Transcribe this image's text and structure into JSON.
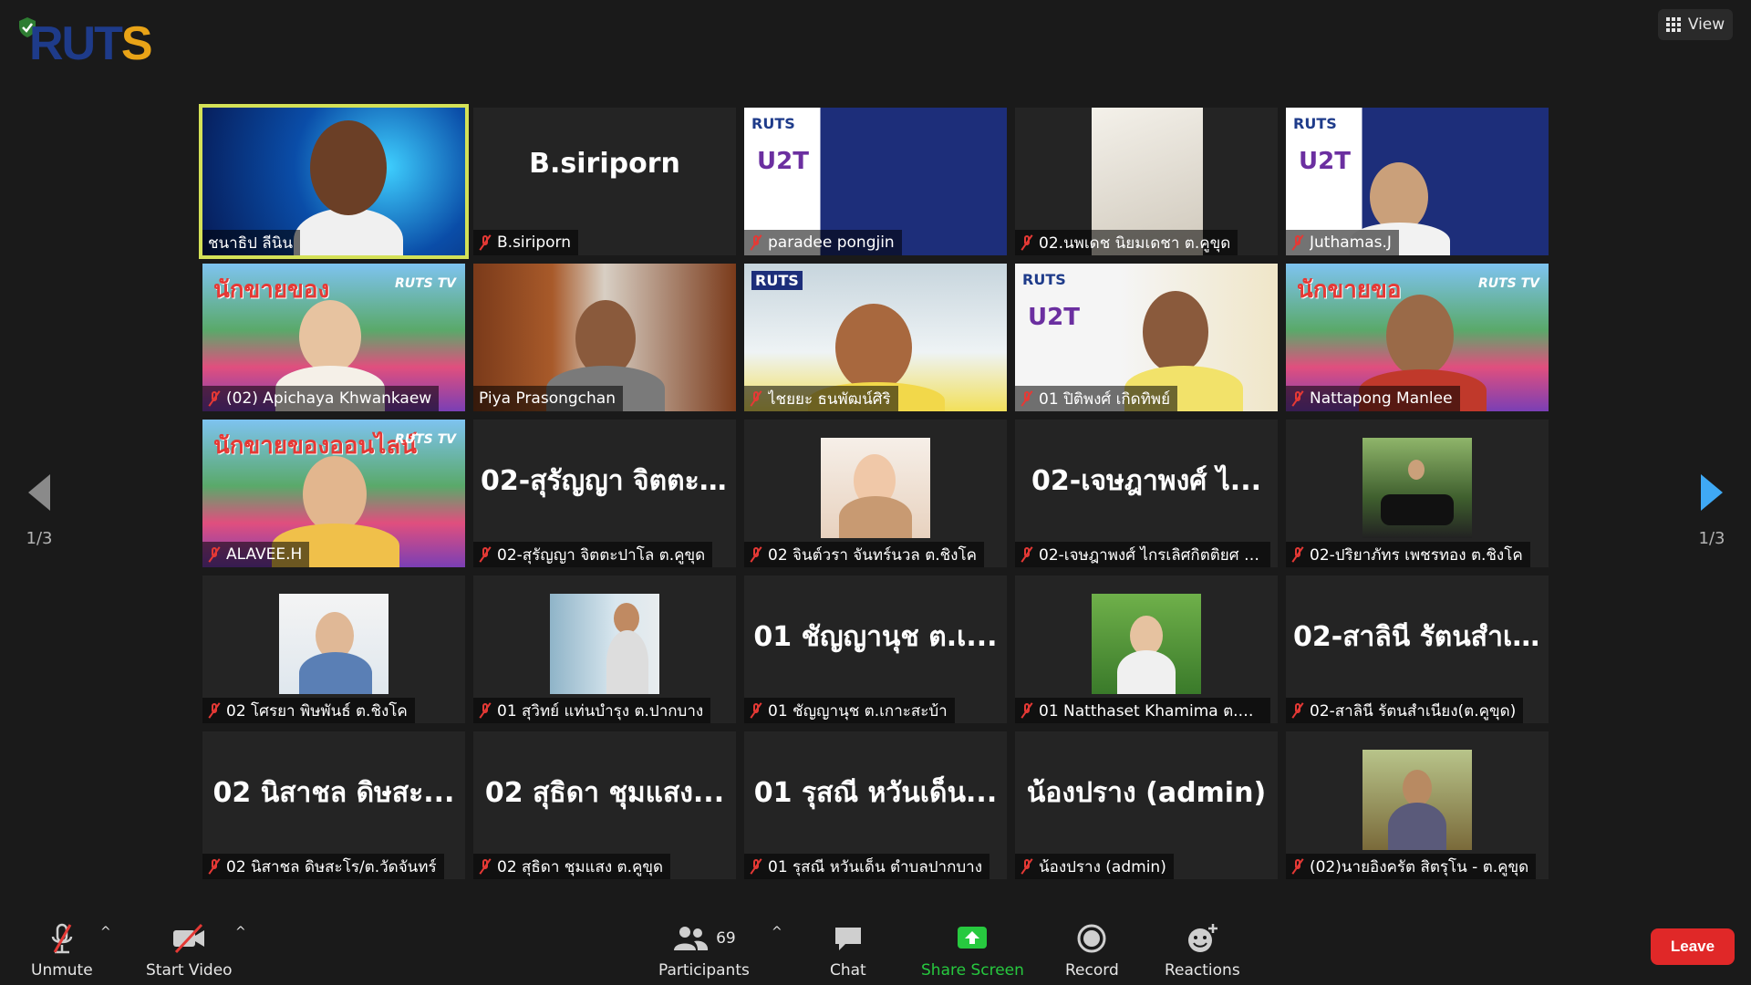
{
  "header": {
    "logo": {
      "part1": "RUT",
      "part2": "S"
    },
    "view_label": "View"
  },
  "pagination": {
    "left": "1/3",
    "right": "1/3"
  },
  "tiles": [
    {
      "name": "ชนาธิป ลีนิน",
      "big": "",
      "muted": false,
      "active": true
    },
    {
      "name": "B.siriporn",
      "big": "B.siriporn",
      "muted": true,
      "active": false
    },
    {
      "name": "paradee pongjin",
      "big": "",
      "muted": true,
      "active": false
    },
    {
      "name": "02.นพเดช นิยมเดชา ต.คูขุด",
      "big": "",
      "muted": true,
      "active": false
    },
    {
      "name": "Juthamas.J",
      "big": "",
      "muted": true,
      "active": false
    },
    {
      "name": "(02) Apichaya Khwankaew",
      "big": "",
      "muted": true,
      "active": false
    },
    {
      "name": "Piya Prasongchan",
      "big": "",
      "muted": false,
      "active": false
    },
    {
      "name": "ไชยยะ ธนพัฒน์ศิริ",
      "big": "",
      "muted": true,
      "active": false
    },
    {
      "name": "01 ปิติพงศ์ เกิดทิพย์",
      "big": "",
      "muted": true,
      "active": false
    },
    {
      "name": "Nattapong Manlee",
      "big": "",
      "muted": true,
      "active": false
    },
    {
      "name": "ALAVEE.H",
      "big": "",
      "muted": true,
      "active": false
    },
    {
      "name": "02-สุรัญญา จิตตะปาโล ต.คูขุด",
      "big": "02-สุรัญญา จิตตะ...",
      "muted": true,
      "active": false
    },
    {
      "name": "02 จินต์วรา จันทร์นวล ต.ชิงโค",
      "big": "",
      "muted": true,
      "active": false
    },
    {
      "name": "02-เจษฎาพงศ์ ไกรเลิศกิตติยศ ช...",
      "big": "02-เจษฎาพงศ์ ไ...",
      "muted": true,
      "active": false
    },
    {
      "name": "02-ปริยาภัทร เพชรทอง ต.ชิงโค",
      "big": "",
      "muted": true,
      "active": false
    },
    {
      "name": "02 โศรยา พิษพันธ์ ต.ชิงโค",
      "big": "",
      "muted": true,
      "active": false
    },
    {
      "name": "01 สุวิทย์ แท่นบำรุง ต.ปากบาง",
      "big": "",
      "muted": true,
      "active": false
    },
    {
      "name": "01 ชัญญานุช ต.เกาะสะบ้า",
      "big": "01 ชัญญานุช ต.เ...",
      "muted": true,
      "active": false
    },
    {
      "name": "01 Natthaset Khamima ต.ปา...",
      "big": "",
      "muted": true,
      "active": false
    },
    {
      "name": "02-สาลินี รัตนสำเนียง(ต.คูขุด)",
      "big": "02-สาลินี รัตนสำเ...",
      "muted": true,
      "active": false
    },
    {
      "name": "02 นิสาชล ดิษสะโร/ต.วัดจันทร์",
      "big": "02 นิสาชล ดิษสะ...",
      "muted": true,
      "active": false
    },
    {
      "name": "02 สุธิดา ชุมแสง ต.คูขุด",
      "big": "02 สุธิดา ชุมแสง...",
      "muted": true,
      "active": false
    },
    {
      "name": "01 รุสณี หวันเด็น ตำบลปากบาง",
      "big": "01 รุสณี หวันเด็น...",
      "muted": true,
      "active": false
    },
    {
      "name": "น้องปราง (admin)",
      "big": "น้องปราง (admin)",
      "muted": true,
      "active": false
    },
    {
      "name": "(02)นายอิงครัต สิตรุโน - ต.คูขุด",
      "big": "",
      "muted": true,
      "active": false
    }
  ],
  "toolbar": {
    "unmute": "Unmute",
    "start_video": "Start Video",
    "participants": "Participants",
    "participants_count": "69",
    "chat": "Chat",
    "share_screen": "Share Screen",
    "record": "Record",
    "reactions": "Reactions",
    "leave": "Leave"
  },
  "colors": {
    "background": "#1a1a1a",
    "tile": "#242424",
    "active_border": "#d4e157",
    "muted_red": "#e53935",
    "share_green": "#27c93f",
    "leave_red": "#e02828",
    "next_arrow": "#3fa9f5"
  }
}
